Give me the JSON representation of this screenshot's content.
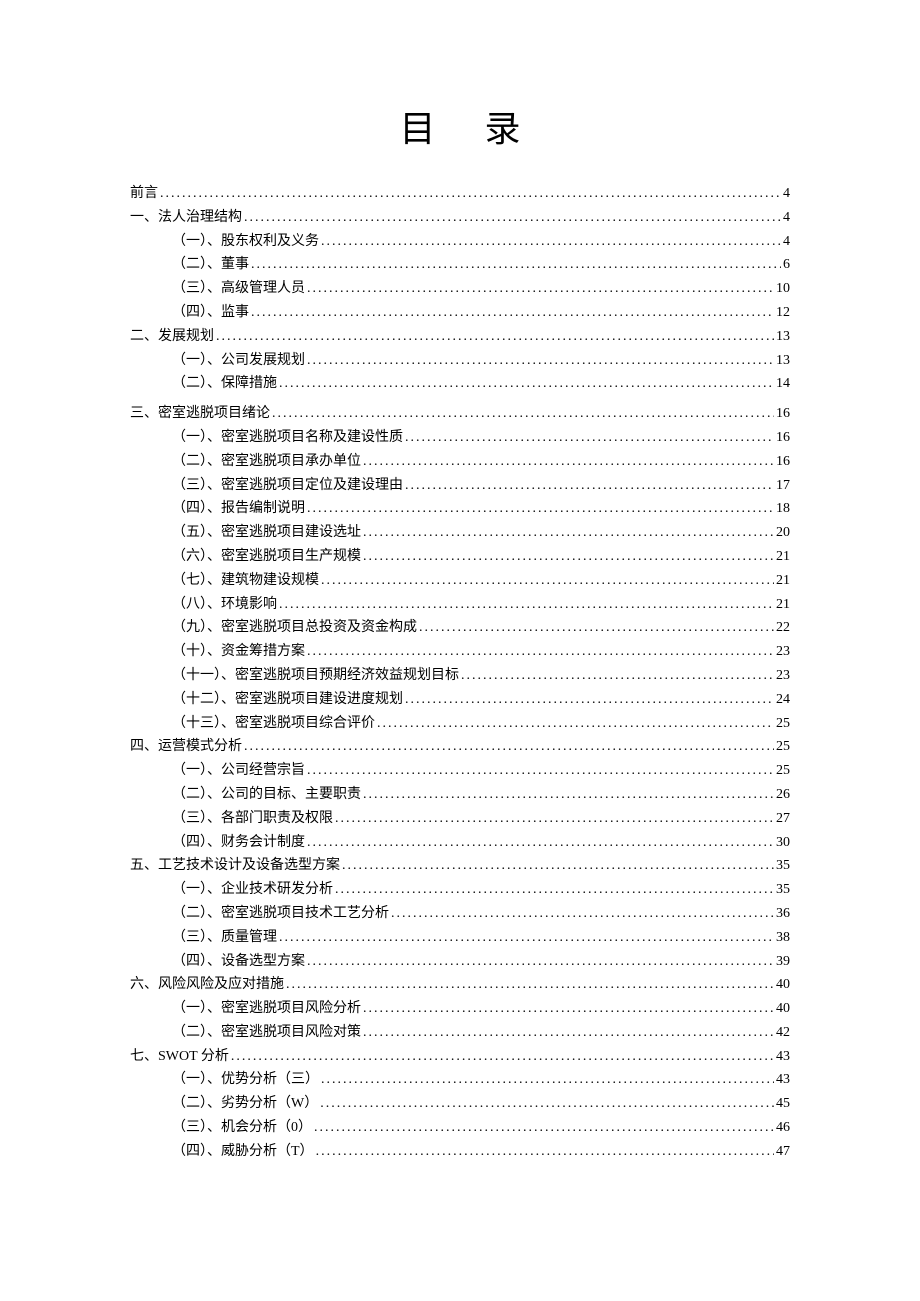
{
  "title": "目 录",
  "toc": [
    {
      "level": 1,
      "label": "前言",
      "page": "4"
    },
    {
      "level": 1,
      "label": "一、法人治理结构",
      "page": "4"
    },
    {
      "level": 2,
      "label": "（一）、股东权利及义务",
      "page": "4"
    },
    {
      "level": 2,
      "label": "（二）、董事",
      "page": "6"
    },
    {
      "level": 2,
      "label": "（三）、高级管理人员",
      "page": "10"
    },
    {
      "level": 2,
      "label": "（四）、监事",
      "page": "12"
    },
    {
      "level": 1,
      "label": "二、发展规划",
      "page": "13"
    },
    {
      "level": 2,
      "label": "（一）、公司发展规划",
      "page": "13"
    },
    {
      "level": 2,
      "label": "（二）、保障措施",
      "page": "14"
    },
    {
      "level": 1,
      "label": "三、密室逃脱项目绪论",
      "page": "16",
      "spaced": true
    },
    {
      "level": 2,
      "label": "（一）、密室逃脱项目名称及建设性质",
      "page": "16"
    },
    {
      "level": 2,
      "label": "（二）、密室逃脱项目承办单位",
      "page": "16"
    },
    {
      "level": 2,
      "label": "（三）、密室逃脱项目定位及建设理由",
      "page": "17"
    },
    {
      "level": 2,
      "label": "（四）、报告编制说明",
      "page": "18"
    },
    {
      "level": 2,
      "label": "（五）、密室逃脱项目建设选址",
      "page": "20"
    },
    {
      "level": 2,
      "label": "（六）、密室逃脱项目生产规模",
      "page": "21"
    },
    {
      "level": 2,
      "label": "（七）、建筑物建设规模",
      "page": "21"
    },
    {
      "level": 2,
      "label": "（八）、环境影响",
      "page": "21"
    },
    {
      "level": 2,
      "label": "（九）、密室逃脱项目总投资及资金构成",
      "page": "22"
    },
    {
      "level": 2,
      "label": "（十）、资金筹措方案",
      "page": "23"
    },
    {
      "level": 2,
      "label": "（十一）、密室逃脱项目预期经济效益规划目标",
      "page": "23"
    },
    {
      "level": 2,
      "label": "（十二）、密室逃脱项目建设进度规划",
      "page": "24"
    },
    {
      "level": 2,
      "label": "（十三）、密室逃脱项目综合评价",
      "page": "25"
    },
    {
      "level": 1,
      "label": "四、运营模式分析",
      "page": "25"
    },
    {
      "level": 2,
      "label": "（一）、公司经营宗旨",
      "page": "25"
    },
    {
      "level": 2,
      "label": "（二）、公司的目标、主要职责",
      "page": "26"
    },
    {
      "level": 2,
      "label": "（三）、各部门职责及权限",
      "page": "27"
    },
    {
      "level": 2,
      "label": "（四）、财务会计制度",
      "page": "30"
    },
    {
      "level": 1,
      "label": "五、工艺技术设计及设备选型方案",
      "page": "35"
    },
    {
      "level": 2,
      "label": "（一）、企业技术研发分析",
      "page": "35"
    },
    {
      "level": 2,
      "label": "（二）、密室逃脱项目技术工艺分析",
      "page": "36"
    },
    {
      "level": 2,
      "label": "（三）、质量管理",
      "page": "38"
    },
    {
      "level": 2,
      "label": "（四）、设备选型方案",
      "page": "39"
    },
    {
      "level": 1,
      "label": "六、风险风险及应对措施",
      "page": "40"
    },
    {
      "level": 2,
      "label": "（一）、密室逃脱项目风险分析",
      "page": "40"
    },
    {
      "level": 2,
      "label": "（二）、密室逃脱项目风险对策",
      "page": "42"
    },
    {
      "level": 1,
      "label": "七、SWOT 分析",
      "page": "43"
    },
    {
      "level": 2,
      "label": "（一）、优势分析（三）",
      "page": "43"
    },
    {
      "level": 2,
      "label": "（二）、劣势分析（W）",
      "page": "45"
    },
    {
      "level": 2,
      "label": "（三）、机会分析（0）",
      "page": "46"
    },
    {
      "level": 2,
      "label": "（四）、威胁分析（T）",
      "page": "47"
    }
  ]
}
